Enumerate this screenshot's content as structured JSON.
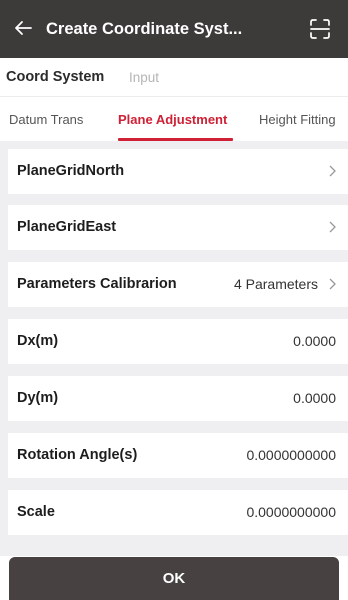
{
  "appbar": {
    "title": "Create Coordinate Syst...",
    "back_icon": "arrow-left-icon",
    "scan_icon": "scan-frame-icon"
  },
  "top_tabs": [
    {
      "label": "Coord System",
      "active": true
    },
    {
      "label": "Input",
      "active": false
    }
  ],
  "sub_tabs": [
    {
      "label": "Datum Trans",
      "active": false
    },
    {
      "label": "Plane Adjustment",
      "active": true
    },
    {
      "label": "Height Fitting",
      "active": false
    }
  ],
  "rows": {
    "plane_grid_north": {
      "label": "PlaneGridNorth"
    },
    "plane_grid_east": {
      "label": "PlaneGridEast"
    },
    "params_calibration": {
      "label": "Parameters Calibrarion",
      "value": "4 Parameters"
    },
    "dx": {
      "label": "Dx(m)",
      "value": "0.0000"
    },
    "dy": {
      "label": "Dy(m)",
      "value": "0.0000"
    },
    "rotation": {
      "label": "Rotation Angle(s)",
      "value": "0.0000000000"
    },
    "scale": {
      "label": "Scale",
      "value": "0.0000000000"
    }
  },
  "ok_button": {
    "label": "OK"
  },
  "colors": {
    "appbar_bg": "#3d3a3a",
    "accent_red": "#cf2035",
    "button_bg": "#474241",
    "page_bg": "#efeff1"
  }
}
